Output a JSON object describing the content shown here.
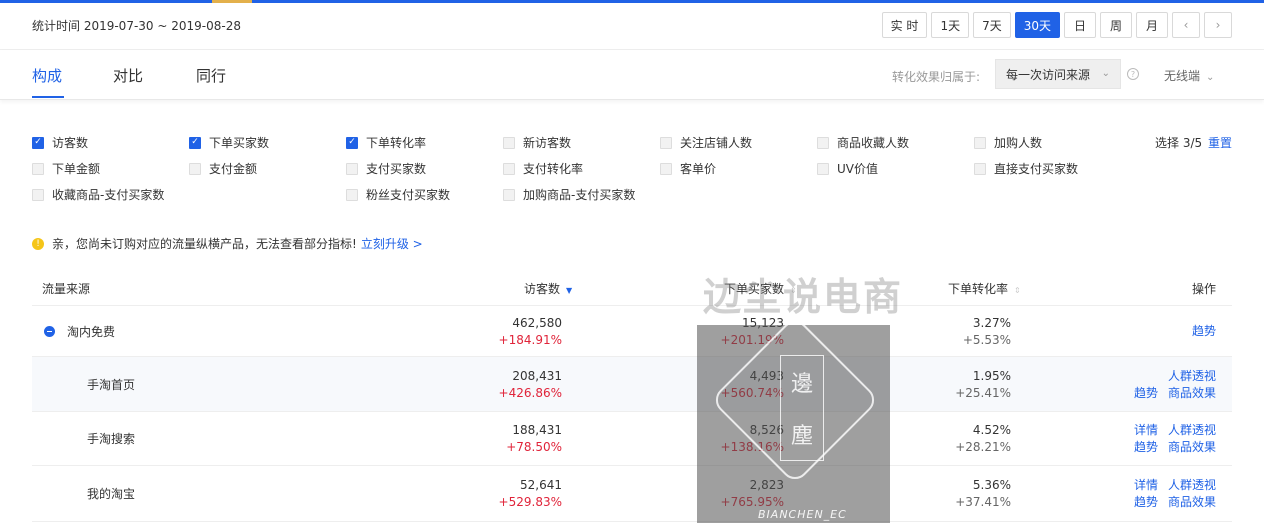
{
  "header": {
    "date_range": "统计时间 2019-07-30 ~ 2019-08-28",
    "ranges": [
      "实 时",
      "1天",
      "7天",
      "30天",
      "日",
      "周",
      "月"
    ],
    "active_range": "30天",
    "prev_icon": "chevron-left-icon",
    "next_icon": "chevron-right-icon"
  },
  "tabs": {
    "items": [
      "构成",
      "对比",
      "同行"
    ],
    "active": "构成",
    "attribution_label": "转化效果归属于:",
    "attribution_value": "每一次访问来源",
    "device": "无线端"
  },
  "metrics": {
    "items": [
      {
        "label": "访客数",
        "checked": true
      },
      {
        "label": "下单买家数",
        "checked": true
      },
      {
        "label": "下单转化率",
        "checked": true
      },
      {
        "label": "新访客数",
        "checked": false
      },
      {
        "label": "关注店铺人数",
        "checked": false
      },
      {
        "label": "商品收藏人数",
        "checked": false
      },
      {
        "label": "加购人数",
        "checked": false
      },
      {
        "label": "下单金额",
        "checked": false
      },
      {
        "label": "支付金额",
        "checked": false
      },
      {
        "label": "支付买家数",
        "checked": false
      },
      {
        "label": "支付转化率",
        "checked": false
      },
      {
        "label": "客单价",
        "checked": false
      },
      {
        "label": "UV价值",
        "checked": false
      },
      {
        "label": "直接支付买家数",
        "checked": false
      },
      {
        "label": "收藏商品-支付买家数",
        "checked": false
      },
      {
        "label": "粉丝支付买家数",
        "checked": false
      },
      {
        "label": "加购商品-支付买家数",
        "checked": false
      }
    ],
    "select_count": "选择 3/5",
    "reset": "重置"
  },
  "notice": {
    "text": "亲，您尚未订购对应的流量纵横产品，无法查看部分指标!",
    "link": "立刻升级 >"
  },
  "table": {
    "headers": {
      "source": "流量来源",
      "visitors": "访客数",
      "buyers": "下单买家数",
      "conversion": "下单转化率",
      "actions": "操作"
    },
    "rows": [
      {
        "name": "淘内免费",
        "group": true,
        "visitors": "462,580",
        "visitors_delta": "+184.91%",
        "buyers": "15,123",
        "buyers_delta": "+201.19%",
        "conv": "3.27%",
        "conv_delta": "+5.53%",
        "ops": [
          [
            "趋势"
          ]
        ]
      },
      {
        "name": "手淘首页",
        "group": false,
        "visitors": "208,431",
        "visitors_delta": "+426.86%",
        "buyers": "4,493",
        "buyers_delta": "+560.74%",
        "conv": "1.95%",
        "conv_delta": "+25.41%",
        "ops": [
          [
            "人群透视"
          ],
          [
            "趋势",
            "商品效果"
          ]
        ]
      },
      {
        "name": "手淘搜索",
        "group": false,
        "visitors": "188,431",
        "visitors_delta": "+78.50%",
        "buyers": "8,526",
        "buyers_delta": "+138.16%",
        "conv": "4.52%",
        "conv_delta": "+28.21%",
        "ops": [
          [
            "详情",
            "人群透视"
          ],
          [
            "趋势",
            "商品效果"
          ]
        ]
      },
      {
        "name": "我的淘宝",
        "group": false,
        "visitors": "52,641",
        "visitors_delta": "+529.83%",
        "buyers": "2,823",
        "buyers_delta": "+765.95%",
        "conv": "5.36%",
        "conv_delta": "+37.41%",
        "ops": [
          [
            "详情",
            "人群透视"
          ],
          [
            "趋势",
            "商品效果"
          ]
        ]
      }
    ]
  },
  "watermark": {
    "title": "边尘说电商",
    "seal_chars": [
      "邊",
      "塵"
    ],
    "caption": "BIANCHEN_EC"
  },
  "colors": {
    "accent": "#2062e6",
    "delta_red": "#e0243a",
    "highlight_row": "#f7f9fc"
  }
}
